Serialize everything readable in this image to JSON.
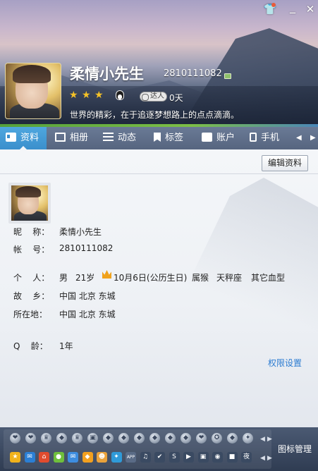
{
  "header": {
    "nickname": "柔情小先生",
    "qq_number": "2810111082",
    "daren_label": "达人",
    "daren_days": "0天",
    "signature": "世界的精彩，在于追逐梦想路上的点点滴滴。"
  },
  "tabs": [
    "资料",
    "相册",
    "动态",
    "标签",
    "账户",
    "手机"
  ],
  "profile": {
    "edit_button": "编辑资料",
    "labels": {
      "nickname": "昵    称：",
      "account": "帐    号：",
      "personal": "个    人：",
      "hometown": "故    乡：",
      "location": "所在地：",
      "qage": "Q    龄："
    },
    "nickname": "柔情小先生",
    "account": "2810111082",
    "personal": {
      "gender": "男",
      "age": "21岁",
      "birthday": "10月6日(公历生日)",
      "zodiac": "属猴",
      "constellation": "天秤座",
      "blood_type": "其它血型"
    },
    "hometown": "中国 北京 东城",
    "location": "中国 北京 东城",
    "qage": "1年",
    "permission_link": "权限设置"
  },
  "iconbar": {
    "manage_label": "图标管理",
    "row2_badges": [
      {
        "name": "star-badge-icon",
        "glyph": "★",
        "color": "#f0b21c"
      },
      {
        "name": "qqmail-badge-icon",
        "glyph": "✉",
        "color": "#2b7fd4"
      },
      {
        "name": "house-badge-icon",
        "glyph": "⌂",
        "color": "#e04b2e"
      },
      {
        "name": "chat-badge-icon",
        "glyph": "●",
        "color": "#6fbf3c"
      },
      {
        "name": "mail-badge-icon",
        "glyph": "✉",
        "color": "#3d8de0"
      },
      {
        "name": "shield-badge-icon",
        "glyph": "◆",
        "color": "#f2a01f"
      },
      {
        "name": "pet-badge-icon",
        "glyph": "☻",
        "color": "#e9a23b"
      },
      {
        "name": "game-badge-icon",
        "glyph": "✦",
        "color": "#2f9ad8"
      },
      {
        "name": "app-badge-icon",
        "glyph": "APP",
        "color": "#5a6b86"
      },
      {
        "name": "music-badge-icon",
        "glyph": "♫",
        "color": "#3a4a62"
      },
      {
        "name": "shield2-badge-icon",
        "glyph": "✔",
        "color": "#3a4a62"
      },
      {
        "name": "safe-badge-icon",
        "glyph": "S",
        "color": "#3a4a62"
      },
      {
        "name": "video-badge-icon",
        "glyph": "▶",
        "color": "#3a4a62"
      },
      {
        "name": "box-badge-icon",
        "glyph": "▣",
        "color": "#3a4a62"
      },
      {
        "name": "camera-badge-icon",
        "glyph": "◉",
        "color": "#3a4a62"
      },
      {
        "name": "gift-badge-icon",
        "glyph": "■",
        "color": "#3a4a62"
      },
      {
        "name": "night-badge-icon",
        "glyph": "夜",
        "color": "#3a4a62"
      }
    ]
  },
  "colors": {
    "active_tab": "#3a8fcc",
    "link": "#2a7bd1",
    "star": "#f5c227"
  }
}
